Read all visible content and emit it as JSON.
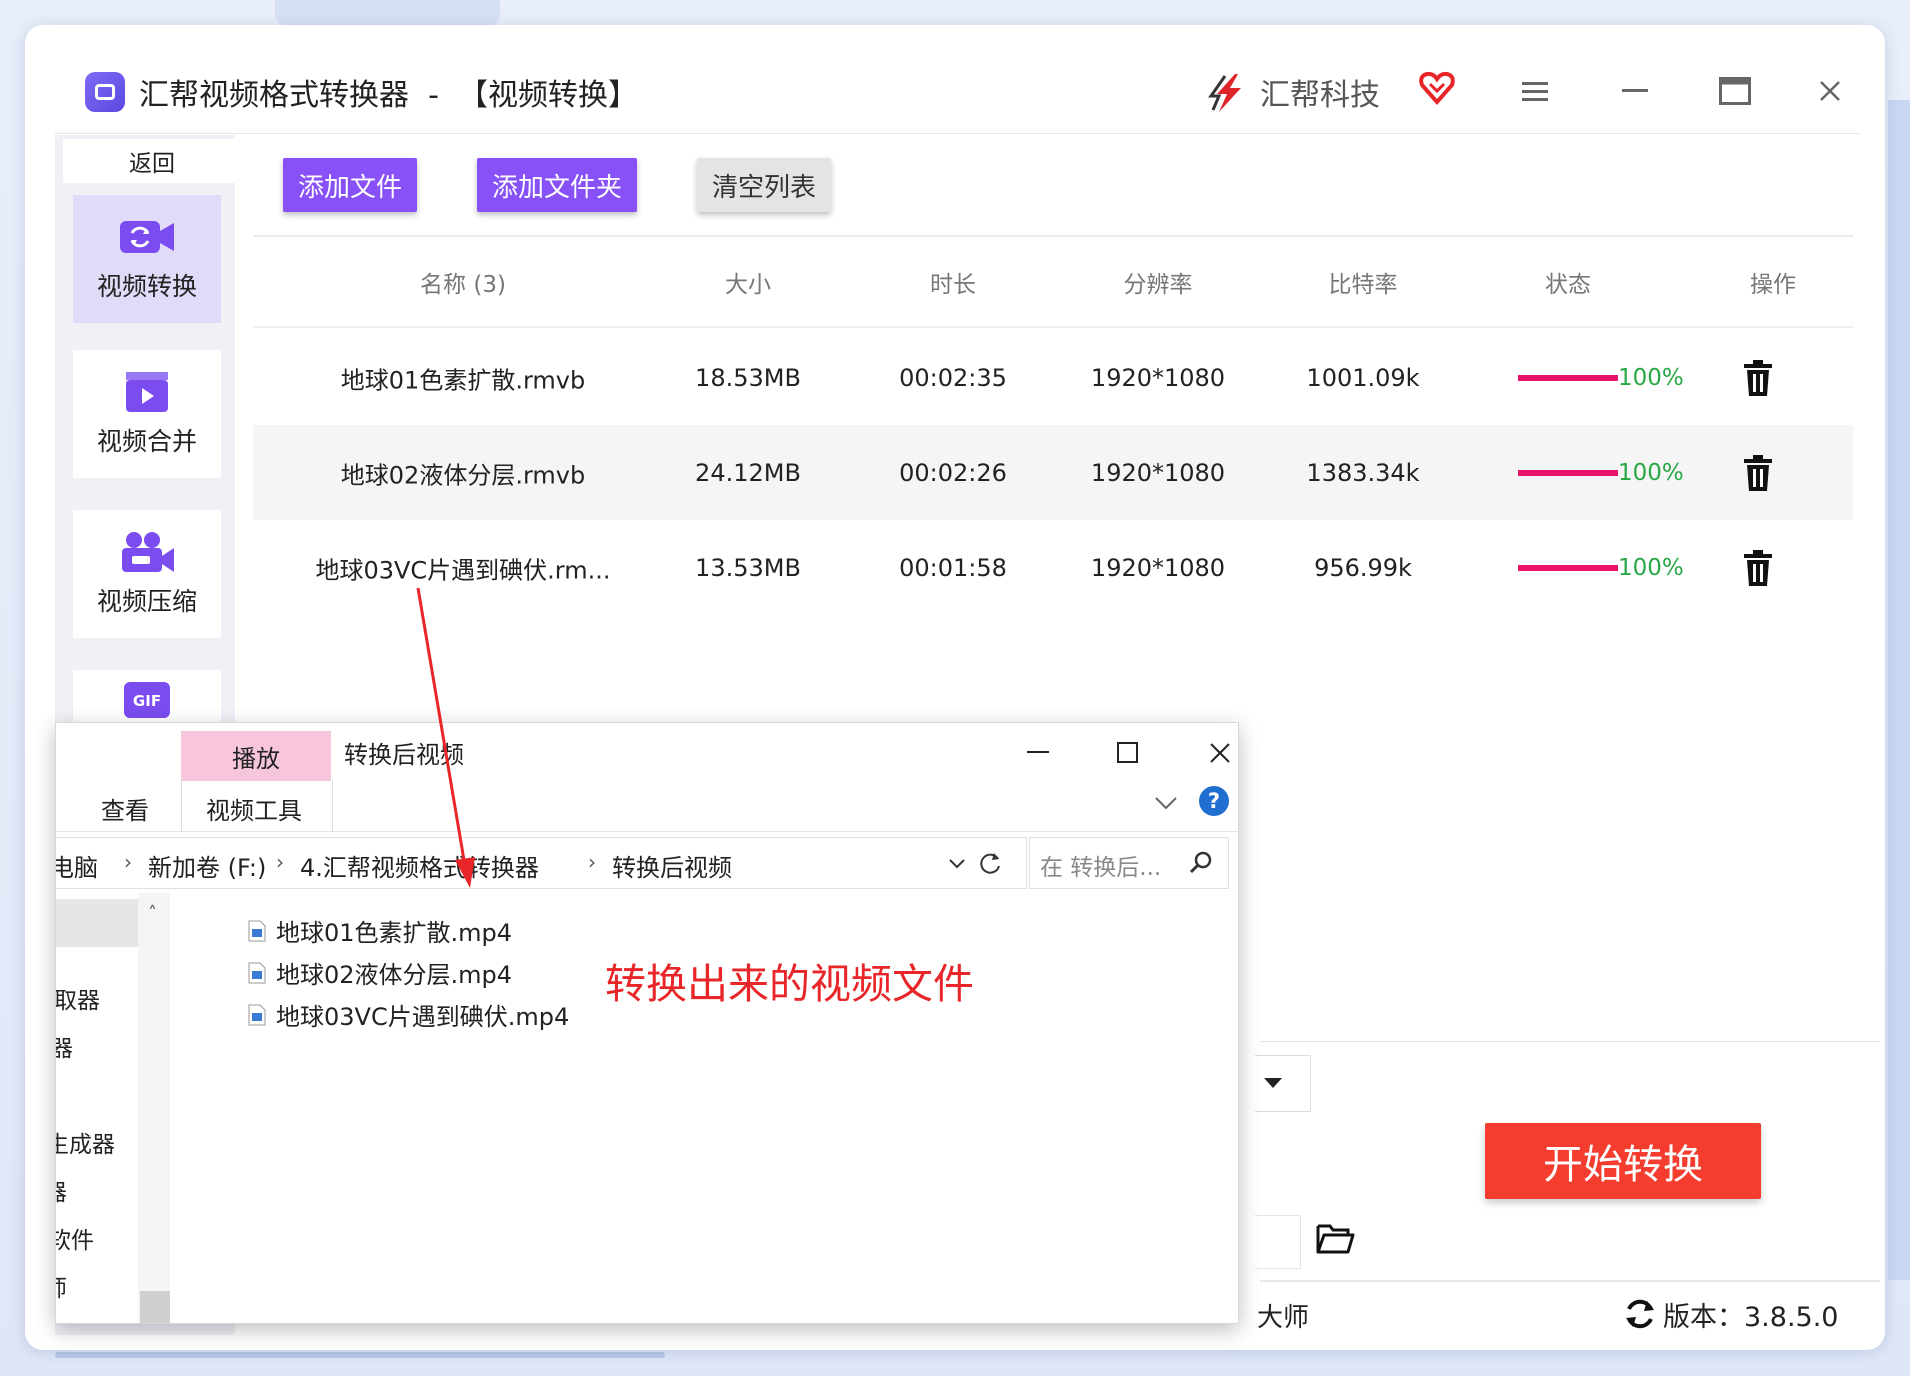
{
  "app": {
    "title": "汇帮视频格式转换器  -  【视频转换】",
    "brand": "汇帮科技"
  },
  "sidebar": {
    "back_label": "返回",
    "items": [
      {
        "label": "视频转换",
        "icon": "video-convert-icon",
        "active": true
      },
      {
        "label": "视频合并",
        "icon": "video-merge-icon"
      },
      {
        "label": "视频压缩",
        "icon": "video-compress-icon"
      },
      {
        "label": "",
        "icon": "gif-icon"
      }
    ]
  },
  "toolbar": {
    "add_file": "添加文件",
    "add_folder": "添加文件夹",
    "clear_list": "清空列表"
  },
  "table": {
    "columns": [
      "名称 (3)",
      "大小",
      "时长",
      "分辨率",
      "比特率",
      "状态",
      "操作"
    ],
    "rows": [
      {
        "name": "地球01色素扩散.rmvb",
        "size": "18.53MB",
        "duration": "00:02:35",
        "resolution": "1920*1080",
        "bitrate": "1001.09k",
        "progress": "100%"
      },
      {
        "name": "地球02液体分层.rmvb",
        "size": "24.12MB",
        "duration": "00:02:26",
        "resolution": "1920*1080",
        "bitrate": "1383.34k",
        "progress": "100%"
      },
      {
        "name": "地球03VC片遇到碘伏.rm...",
        "size": "13.53MB",
        "duration": "00:01:58",
        "resolution": "1920*1080",
        "bitrate": "956.99k",
        "progress": "100%"
      }
    ]
  },
  "actions": {
    "start_convert": "开始转换",
    "fragment_text": "大师",
    "version": "版本：3.8.5.0"
  },
  "explorer": {
    "tab_play": "播放",
    "title": "转换后视频",
    "tab_view": "查看",
    "tab_video_tools": "视频工具",
    "breadcrumb": [
      "电脑",
      "新加卷 (F:)",
      "4.汇帮视频格式转换器",
      "转换后视频"
    ],
    "search_placeholder": "在 转换后...",
    "nav_items": [
      "取器",
      "器",
      "生成器",
      "器",
      "软件",
      "师"
    ],
    "files": [
      "地球01色素扩散.mp4",
      "地球02液体分层.mp4",
      "地球03VC片遇到碘伏.mp4"
    ]
  },
  "annotation": "转换出来的视频文件",
  "colors": {
    "accent_purple": "#8751f7",
    "start_red": "#f43d2f",
    "progress_pink": "#e8146c",
    "percent_green": "#28a745",
    "annotation_red": "#e8262a"
  }
}
